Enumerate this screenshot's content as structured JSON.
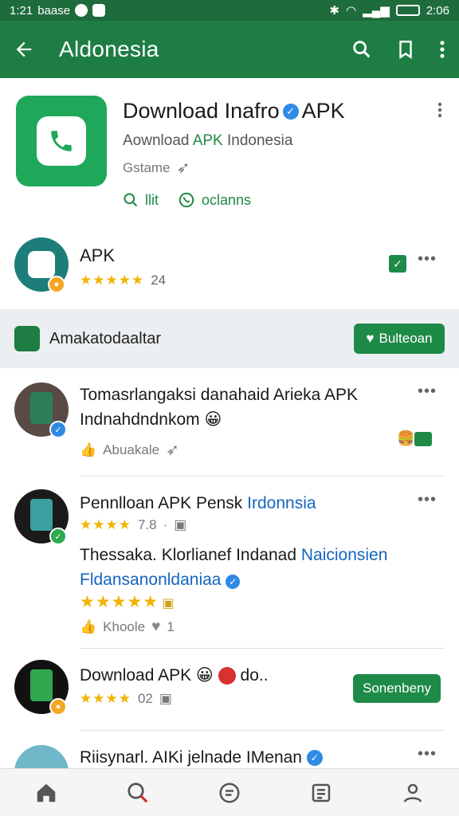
{
  "status": {
    "time_left": "1:21",
    "carrier": "baase",
    "time_right": "2:06",
    "colors": {
      "bar": "#1e6b3c"
    }
  },
  "appbar": {
    "title": "Aldonesia",
    "icons": [
      "back-arrow-icon",
      "search-icon",
      "bookmark-icon",
      "more-vertical-icon"
    ],
    "color": "#1e7d43"
  },
  "hero": {
    "title": "Download Inafro",
    "title_suffix": "APK",
    "subtitle_prefix": "Aownload",
    "subtitle_accent": "APK",
    "subtitle_rest": "Indonesia",
    "meta": "Gstame",
    "link1": "llit",
    "link2": "oclanns"
  },
  "app_row": {
    "name": "APK",
    "stars": "★★★★★",
    "count": "24"
  },
  "section": {
    "title": "Amakatodaaltar",
    "button": "Bulteoan"
  },
  "posts": [
    {
      "title": "Tomasrlangaksi danahaid Arieka APK Indnahdndnkom 😀",
      "meta": "Abuakale",
      "extra_label": "",
      "stars": "",
      "rating": ""
    },
    {
      "title_main": "Pennlloan APK Pensk",
      "title_accent": "Irdonnsia",
      "stars": "★★★★",
      "rating": "7.8",
      "body_black": "Thessaka. Klorlianef Indanad",
      "body_blue": "Naicionsien Fldansanonldaniaa",
      "stars2": "★★★★★",
      "meta": "Khoole",
      "meta_count": "1"
    },
    {
      "title": "Download APK 😀",
      "title_end": "do..",
      "stars": "★★★★",
      "rating": "02",
      "button": "Sonenbeny"
    },
    {
      "title": "Riisynarl. AIKi jelnade IMenan"
    }
  ],
  "bottom_nav": [
    "home-icon",
    "search-icon",
    "chat-icon",
    "news-icon",
    "profile-icon"
  ]
}
